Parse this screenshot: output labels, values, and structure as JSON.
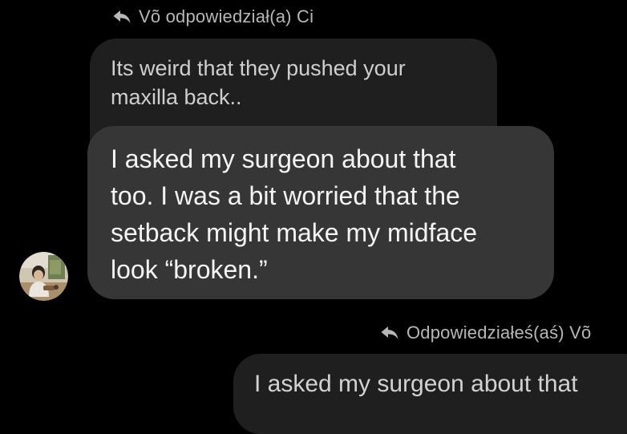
{
  "thread": {
    "reply_header_top": "Võ odpowiedział(a) Ci",
    "quoted_text_top": "Its weird that they pushed your\nmaxilla back..",
    "message_text": "I asked my surgeon about that\ntoo. I was a bit worried that the\nsetback might make my midface\nlook “broken.”",
    "reply_header_bottom": "Odpowiedziałeś(aś) Võ",
    "quoted_text_bottom": "I asked my surgeon about that"
  },
  "icons": {
    "reply": "reply-arrow-icon",
    "avatar": "user-avatar-photo"
  },
  "colors": {
    "background": "#000000",
    "bubble_received": "#363636",
    "bubble_quoted": "#1f1f1f",
    "meta_text": "#b7b7b7"
  }
}
